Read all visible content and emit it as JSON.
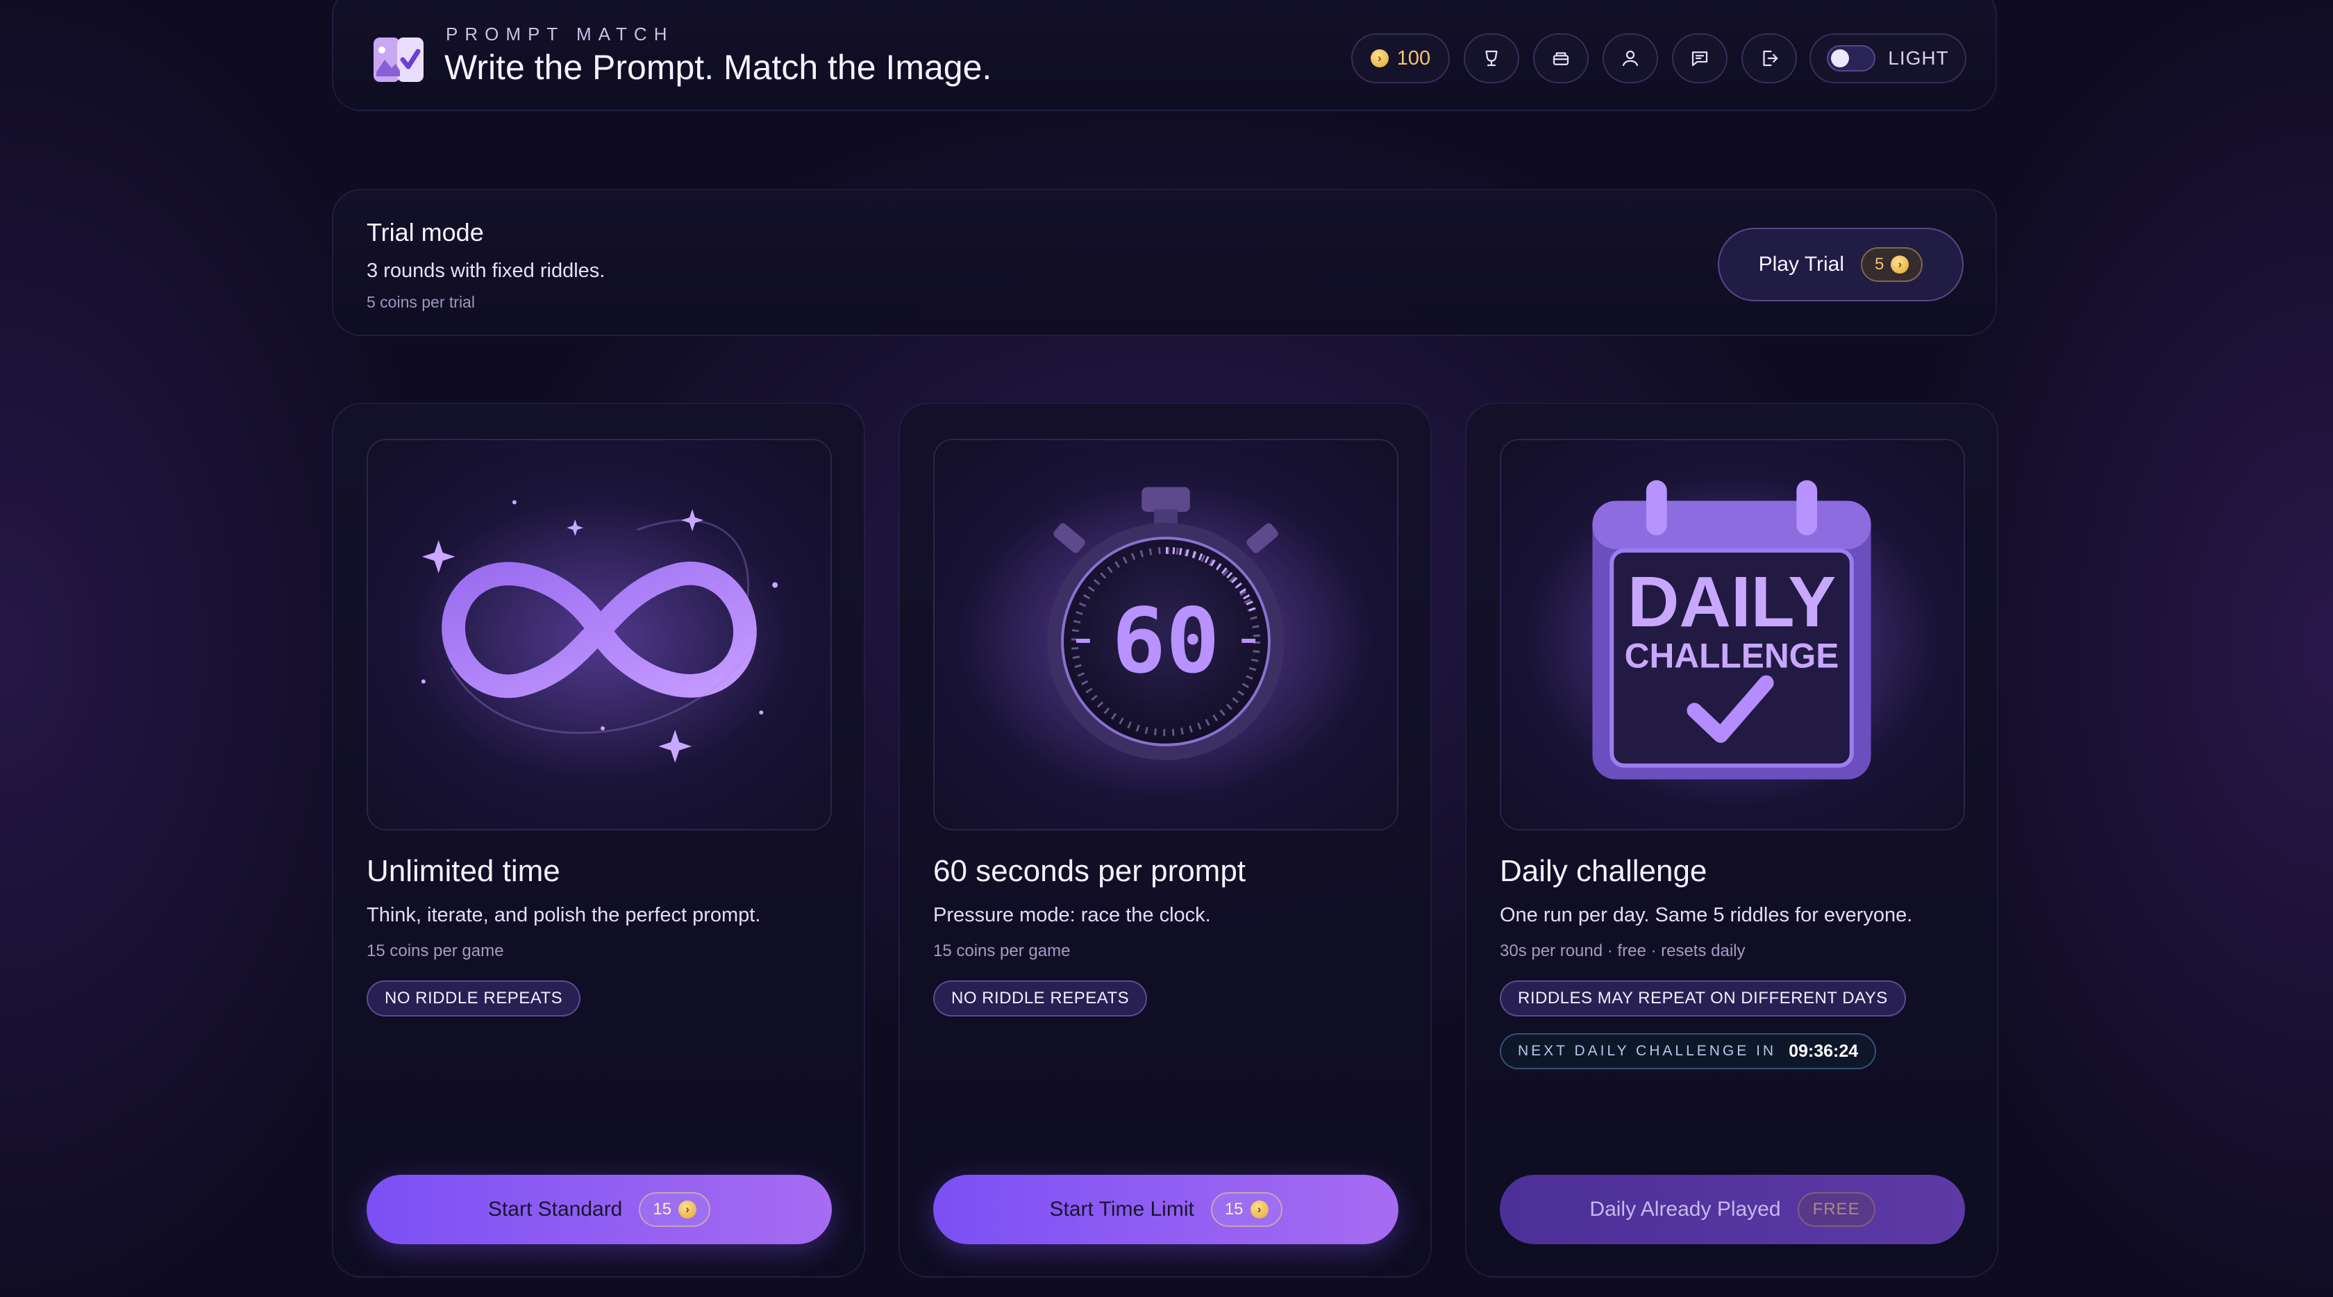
{
  "header": {
    "kicker": "PROMPT MATCH",
    "title": "Write the Prompt. Match the Image.",
    "coins": "100",
    "theme_label": "LIGHT",
    "icons": [
      "trophy-icon",
      "shop-icon",
      "profile-icon",
      "feedback-icon",
      "logout-icon"
    ]
  },
  "trial": {
    "title": "Trial mode",
    "description": "3 rounds with fixed riddles.",
    "note": "5 coins per trial",
    "button_label": "Play Trial",
    "cost": "5"
  },
  "cards": [
    {
      "title": "Unlimited time",
      "description": "Think, iterate, and polish the perfect prompt.",
      "note": "15 coins per game",
      "tag": "NO RIDDLE REPEATS",
      "button_label": "Start Standard",
      "cost": "15"
    },
    {
      "title": "60 seconds per prompt",
      "description": "Pressure mode: race the clock.",
      "note": "15 coins per game",
      "tag": "NO RIDDLE REPEATS",
      "button_label": "Start Time Limit",
      "cost": "15",
      "art_number": "60"
    },
    {
      "title": "Daily challenge",
      "description": "One run per day. Same 5 riddles for everyone.",
      "note": "30s per round · free · resets daily",
      "tag": "RIDDLES MAY REPEAT ON DIFFERENT DAYS",
      "countdown_label": "NEXT DAILY CHALLENGE IN",
      "countdown_value": "09:36:24",
      "button_label": "Daily Already Played",
      "cost": "FREE",
      "art_line1": "DAILY",
      "art_line2": "CHALLENGE"
    }
  ],
  "colors": {
    "background": "#0f0c22",
    "accent": "#8b5cf6",
    "coin": "#f5c76a"
  }
}
